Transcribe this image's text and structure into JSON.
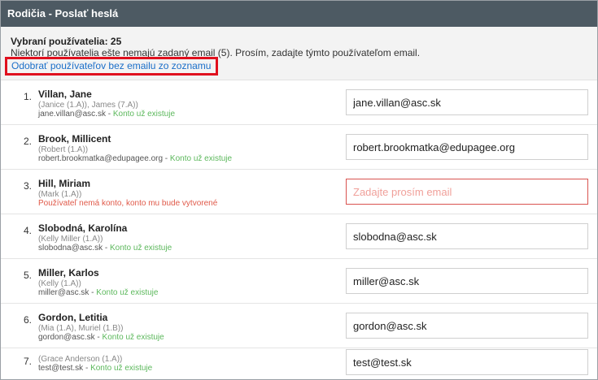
{
  "title": "Rodičia - Poslať heslá",
  "summary": {
    "count_label": "Vybraní používatelia: 25",
    "note": "Niektorí používatelia ešte nemajú zadaný email (5). Prosím, zadajte týmto používateľom email.",
    "remove_link": "Odobrať používateľov bez emailu zo zoznamu"
  },
  "status_texts": {
    "exists": "Konto už existuje",
    "will_create": "Používateľ nemá konto, konto mu bude vytvorené"
  },
  "email_placeholder": "Zadajte prosím email",
  "rows": [
    {
      "num": "1.",
      "name": "Villan, Jane",
      "kids": "(Janice (1.A)), James (7.A))",
      "login": "jane.villan@asc.sk",
      "sep": " - ",
      "status": "Konto už existuje",
      "email": "jane.villan@asc.sk"
    },
    {
      "num": "2.",
      "name": "Brook, Millicent",
      "kids": "(Robert (1.A))",
      "login": "robert.brookmatka@edupagee.org",
      "sep": " - ",
      "status": "Konto už existuje",
      "email": "robert.brookmatka@edupagee.org"
    },
    {
      "num": "3.",
      "name": "Hill, Miriam",
      "kids": "(Mark (1.A))",
      "login": "",
      "sep": "",
      "status": "Používateľ nemá konto, konto mu bude vytvorené",
      "email": ""
    },
    {
      "num": "4.",
      "name": "Slobodná, Karolína",
      "kids": "(Kelly Miller (1.A))",
      "login": "slobodna@asc.sk",
      "sep": " - ",
      "status": "Konto už existuje",
      "email": "slobodna@asc.sk"
    },
    {
      "num": "5.",
      "name": "Miller, Karlos",
      "kids": "(Kelly (1.A))",
      "login": "miller@asc.sk",
      "sep": " - ",
      "status": "Konto už existuje",
      "email": "miller@asc.sk"
    },
    {
      "num": "6.",
      "name": "Gordon, Letitia",
      "kids": "(Mia (1.A), Muriel (1.B))",
      "login": "gordon@asc.sk",
      "sep": " - ",
      "status": "Konto už existuje",
      "email": "gordon@asc.sk"
    },
    {
      "num": "7.",
      "name": "",
      "kids": "(Grace Anderson (1.A))",
      "login": "test@test.sk",
      "sep": " - ",
      "status": "Konto už existuje",
      "email": "test@test.sk"
    }
  ]
}
